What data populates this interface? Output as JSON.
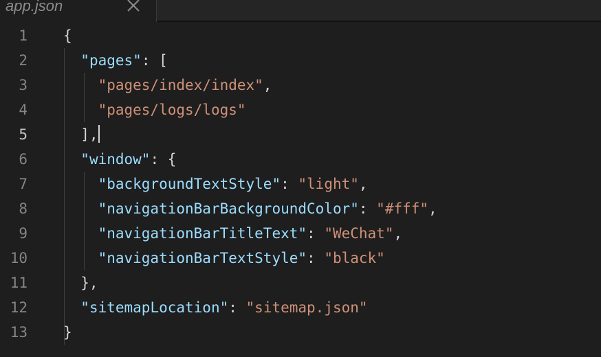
{
  "tab": {
    "title": "app.json",
    "close_icon": "close-icon"
  },
  "editor": {
    "active_line": 5,
    "lines": [
      {
        "number": "1",
        "parts": [
          {
            "t": "p",
            "v": "{"
          }
        ]
      },
      {
        "number": "2",
        "parts": [
          {
            "t": "p",
            "v": "  "
          },
          {
            "t": "k",
            "v": "\"pages\""
          },
          {
            "t": "p",
            "v": ": ["
          }
        ]
      },
      {
        "number": "3",
        "parts": [
          {
            "t": "p",
            "v": "    "
          },
          {
            "t": "s",
            "v": "\"pages/index/index\""
          },
          {
            "t": "p",
            "v": ","
          }
        ]
      },
      {
        "number": "4",
        "parts": [
          {
            "t": "p",
            "v": "    "
          },
          {
            "t": "s",
            "v": "\"pages/logs/logs\""
          }
        ]
      },
      {
        "number": "5",
        "parts": [
          {
            "t": "p",
            "v": "  ],"
          },
          {
            "t": "c",
            "v": ""
          }
        ]
      },
      {
        "number": "6",
        "parts": [
          {
            "t": "p",
            "v": "  "
          },
          {
            "t": "k",
            "v": "\"window\""
          },
          {
            "t": "p",
            "v": ": {"
          }
        ]
      },
      {
        "number": "7",
        "parts": [
          {
            "t": "p",
            "v": "    "
          },
          {
            "t": "k",
            "v": "\"backgroundTextStyle\""
          },
          {
            "t": "p",
            "v": ": "
          },
          {
            "t": "s",
            "v": "\"light\""
          },
          {
            "t": "p",
            "v": ","
          }
        ]
      },
      {
        "number": "8",
        "parts": [
          {
            "t": "p",
            "v": "    "
          },
          {
            "t": "k",
            "v": "\"navigationBarBackgroundColor\""
          },
          {
            "t": "p",
            "v": ": "
          },
          {
            "t": "s",
            "v": "\"#fff\""
          },
          {
            "t": "p",
            "v": ","
          }
        ]
      },
      {
        "number": "9",
        "parts": [
          {
            "t": "p",
            "v": "    "
          },
          {
            "t": "k",
            "v": "\"navigationBarTitleText\""
          },
          {
            "t": "p",
            "v": ": "
          },
          {
            "t": "s",
            "v": "\"WeChat\""
          },
          {
            "t": "p",
            "v": ","
          }
        ]
      },
      {
        "number": "10",
        "parts": [
          {
            "t": "p",
            "v": "    "
          },
          {
            "t": "k",
            "v": "\"navigationBarTextStyle\""
          },
          {
            "t": "p",
            "v": ": "
          },
          {
            "t": "s",
            "v": "\"black\""
          }
        ]
      },
      {
        "number": "11",
        "parts": [
          {
            "t": "p",
            "v": "  },"
          }
        ]
      },
      {
        "number": "12",
        "parts": [
          {
            "t": "p",
            "v": "  "
          },
          {
            "t": "k",
            "v": "\"sitemapLocation\""
          },
          {
            "t": "p",
            "v": ": "
          },
          {
            "t": "s",
            "v": "\"sitemap.json\""
          }
        ]
      },
      {
        "number": "13",
        "parts": [
          {
            "t": "p",
            "v": "}"
          }
        ]
      }
    ]
  },
  "colors": {
    "background": "#1e1e1e",
    "key": "#9cdcfe",
    "string": "#ce9178",
    "punctuation": "#d4d4d4",
    "line_number": "#858585"
  }
}
